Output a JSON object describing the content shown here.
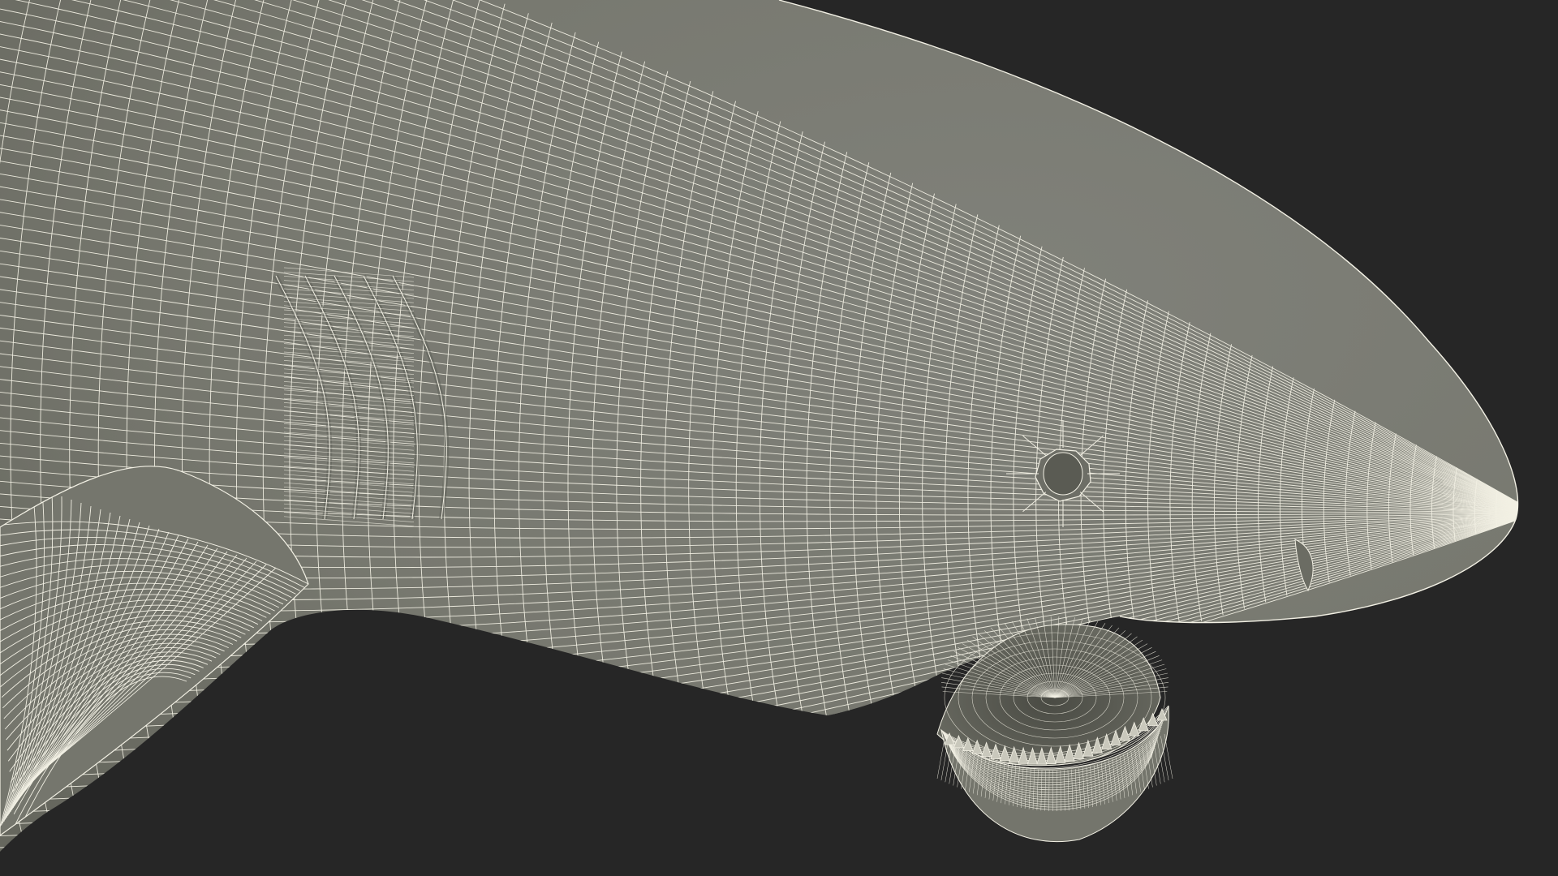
{
  "scene": {
    "subject": "shark-head-wireframe",
    "colors": {
      "background": "#262626",
      "skin": "#7a7b70",
      "skin_shadow": "#5f6058",
      "wire": "#f2f0e4",
      "mouth_inside": "#5a5b52",
      "mouth_deep": "#3e3f39",
      "teeth": "#c9c8bc"
    }
  }
}
